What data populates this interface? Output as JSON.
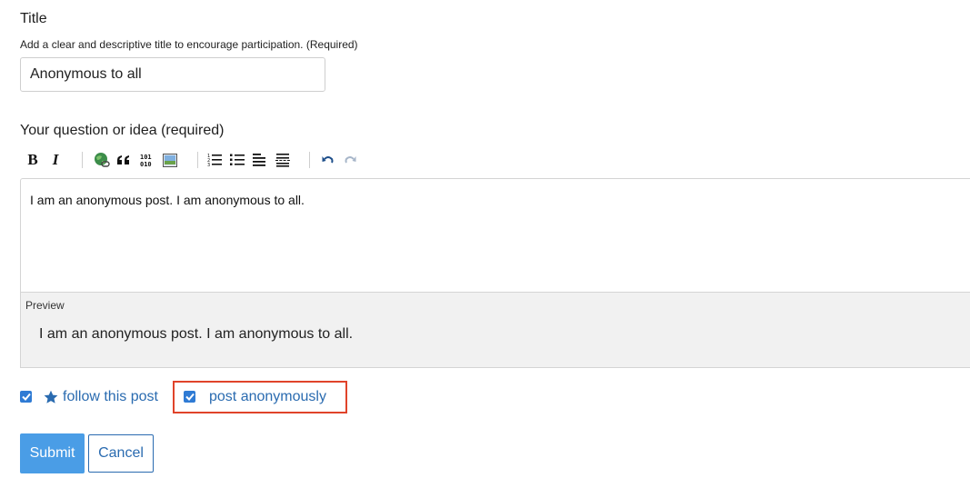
{
  "title_field": {
    "label": "Title",
    "help": "Add a clear and descriptive title to encourage participation. (Required)",
    "value": "Anonymous to all"
  },
  "question_field": {
    "label": "Your question or idea (required)",
    "toolbar": {
      "bold": "B",
      "italic": "I",
      "icons": [
        "link-icon",
        "quote-icon",
        "code-icon",
        "image-icon",
        "numbered-list-icon",
        "bulleted-list-icon",
        "heading-icon",
        "horizontal-rule-icon",
        "undo-icon",
        "redo-icon"
      ]
    },
    "value": "I am an anonymous post. I am anonymous to all."
  },
  "preview": {
    "label": "Preview",
    "text": "I am an anonymous post. I am anonymous to all."
  },
  "options": {
    "follow_label": "follow this post",
    "follow_checked": true,
    "anonymous_label": "post anonymously",
    "anonymous_checked": true
  },
  "buttons": {
    "submit": "Submit",
    "cancel": "Cancel"
  },
  "colors": {
    "accent": "#4a9de6",
    "link": "#2a6bb0",
    "highlight_box": "#e0432a"
  }
}
